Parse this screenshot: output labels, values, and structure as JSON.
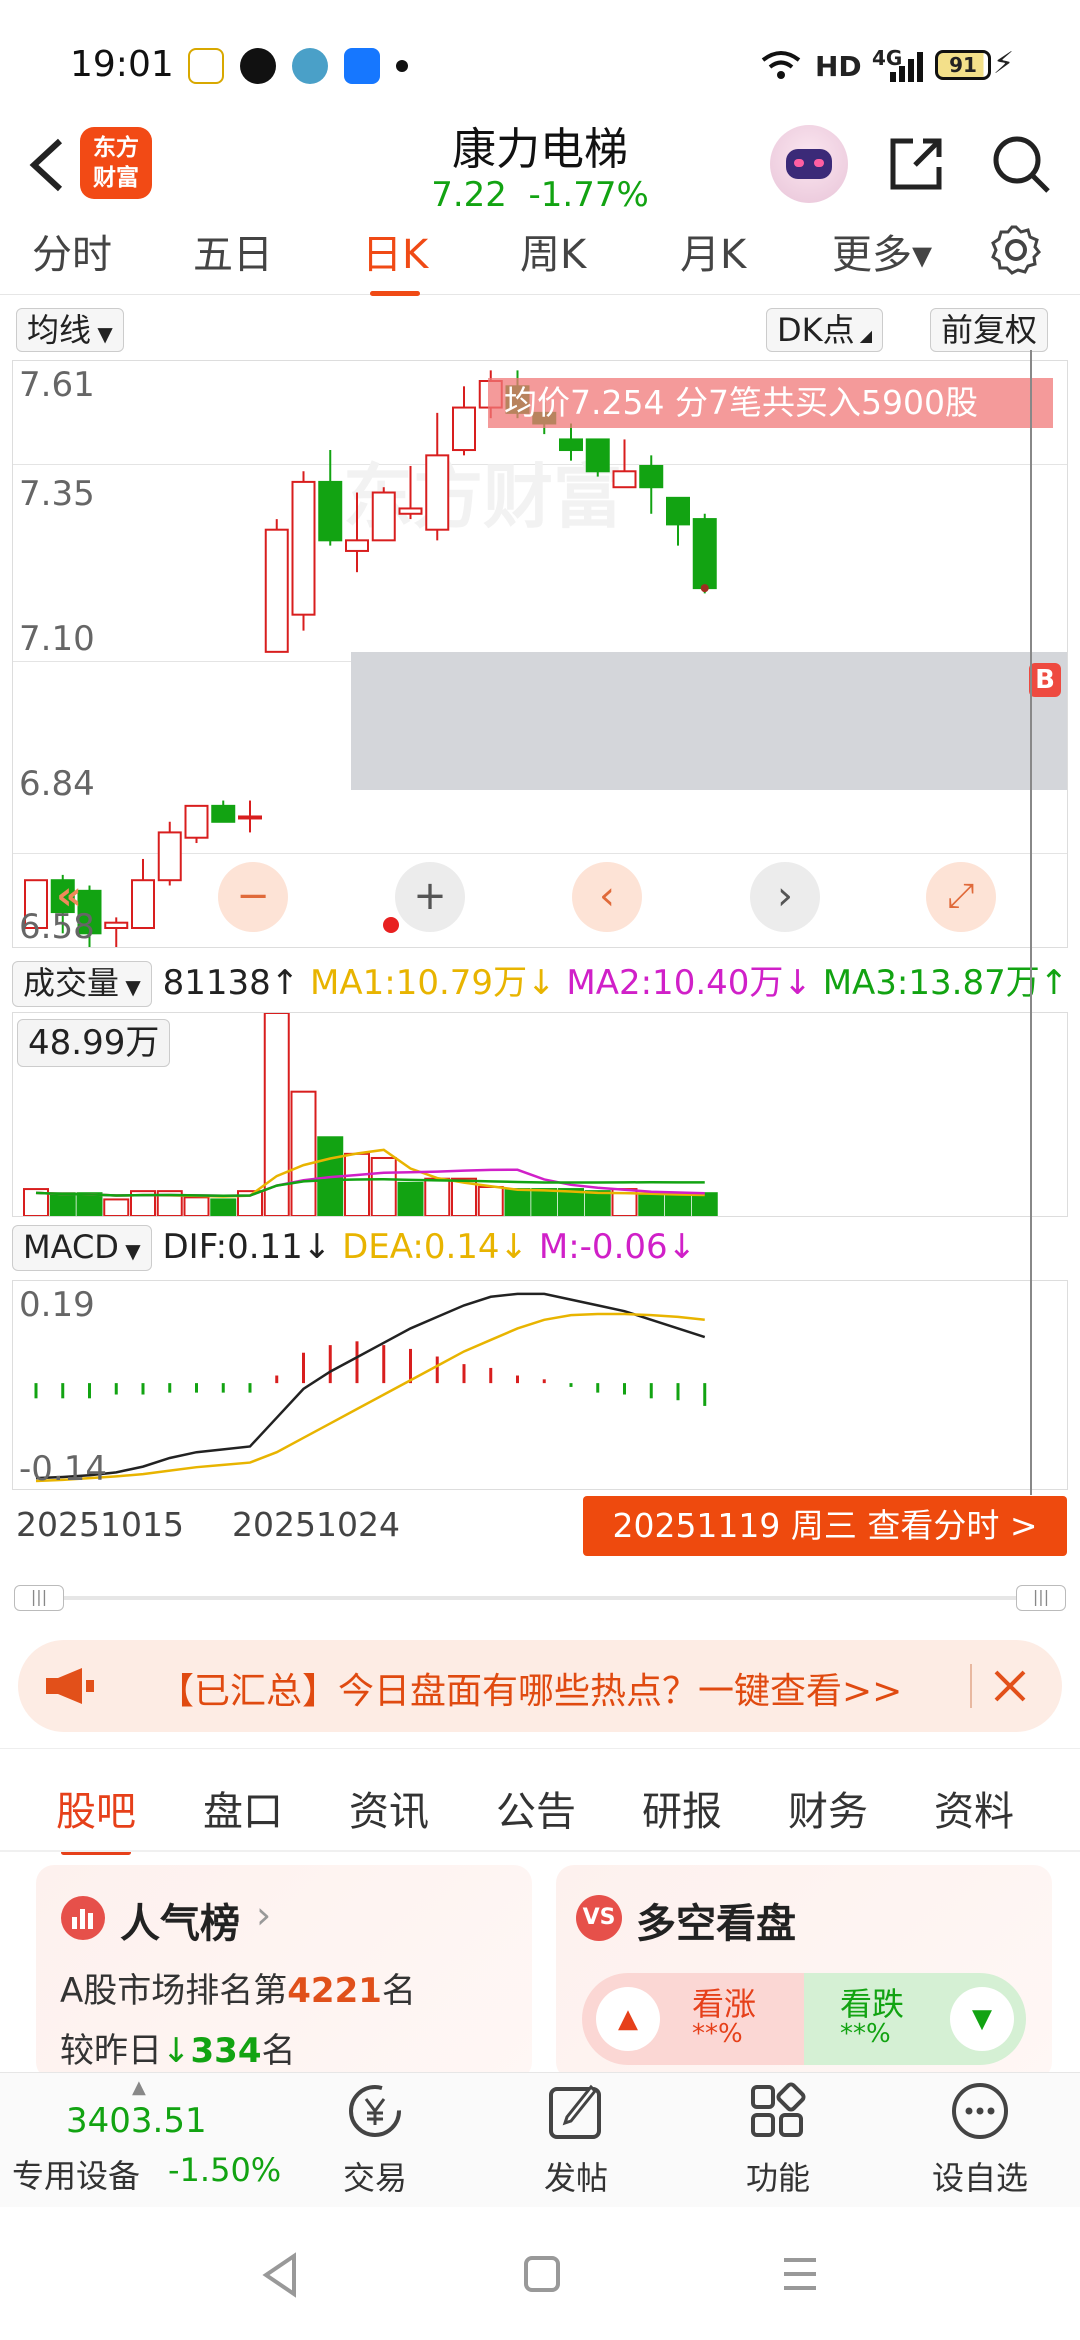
{
  "status_bar": {
    "time": "19:01",
    "net_label": "HD",
    "cell_label": "4G",
    "battery": "91"
  },
  "header": {
    "logo_text": "东方\n财富",
    "title": "康力电梯",
    "price": "7.22",
    "change": "-1.77%"
  },
  "period_tabs": [
    "分时",
    "五日",
    "日K",
    "周K",
    "月K",
    "更多▾"
  ],
  "active_period": "日K",
  "chart_controls": {
    "ma_label": "均线",
    "dk_label": "DK点",
    "adjust_label": "前复权",
    "buy_marker": "B",
    "watermark": "东方财富"
  },
  "trade_tip": "均价7.254 分7笔共买入5900股",
  "colors": {
    "up": "#d81e1e",
    "down": "#12a312",
    "ma1": "#e8b400",
    "ma2": "#d020c8",
    "ma3": "#12a312",
    "accent": "#ee4a0e"
  },
  "chart_data": [
    {
      "type": "candlestick",
      "ylabels": [
        "7.61",
        "7.35",
        "7.10",
        "6.84",
        "6.58"
      ],
      "ylim": [
        6.58,
        7.61
      ],
      "highlight_band": [
        6.84,
        7.1
      ],
      "candles": [
        {
          "o": 6.58,
          "c": 6.67,
          "h": 6.67,
          "l": 6.58
        },
        {
          "o": 6.67,
          "c": 6.61,
          "h": 6.68,
          "l": 6.57
        },
        {
          "o": 6.65,
          "c": 6.57,
          "h": 6.66,
          "l": 6.53
        },
        {
          "o": 6.58,
          "c": 6.59,
          "h": 6.6,
          "l": 6.54
        },
        {
          "o": 6.58,
          "c": 6.67,
          "h": 6.71,
          "l": 6.58
        },
        {
          "o": 6.67,
          "c": 6.76,
          "h": 6.78,
          "l": 6.66
        },
        {
          "o": 6.75,
          "c": 6.81,
          "h": 6.81,
          "l": 6.74
        },
        {
          "o": 6.81,
          "c": 6.78,
          "h": 6.82,
          "l": 6.78
        },
        {
          "o": 6.79,
          "c": 6.79,
          "h": 6.82,
          "l": 6.76
        },
        {
          "o": 7.1,
          "c": 7.33,
          "h": 7.35,
          "l": 7.1
        },
        {
          "o": 7.17,
          "c": 7.42,
          "h": 7.44,
          "l": 7.14
        },
        {
          "o": 7.42,
          "c": 7.31,
          "h": 7.48,
          "l": 7.3
        },
        {
          "o": 7.29,
          "c": 7.31,
          "h": 7.4,
          "l": 7.25
        },
        {
          "o": 7.31,
          "c": 7.4,
          "h": 7.41,
          "l": 7.31
        },
        {
          "o": 7.36,
          "c": 7.37,
          "h": 7.45,
          "l": 7.35
        },
        {
          "o": 7.33,
          "c": 7.47,
          "h": 7.55,
          "l": 7.31
        },
        {
          "o": 7.48,
          "c": 7.56,
          "h": 7.6,
          "l": 7.47
        },
        {
          "o": 7.56,
          "c": 7.61,
          "h": 7.63,
          "l": 7.54
        },
        {
          "o": 7.6,
          "c": 7.55,
          "h": 7.63,
          "l": 7.54
        },
        {
          "o": 7.55,
          "c": 7.53,
          "h": 7.57,
          "l": 7.51
        },
        {
          "o": 7.5,
          "c": 7.48,
          "h": 7.53,
          "l": 7.46
        },
        {
          "o": 7.5,
          "c": 7.44,
          "h": 7.5,
          "l": 7.43
        },
        {
          "o": 7.41,
          "c": 7.44,
          "h": 7.5,
          "l": 7.41
        },
        {
          "o": 7.45,
          "c": 7.41,
          "h": 7.47,
          "l": 7.36
        },
        {
          "o": 7.39,
          "c": 7.34,
          "h": 7.39,
          "l": 7.3
        },
        {
          "o": 7.35,
          "c": 7.22,
          "h": 7.36,
          "l": 7.21
        }
      ]
    },
    {
      "type": "bar",
      "title": "成交量",
      "legend": {
        "vol": "81138↑",
        "ma1": "MA1:10.79万↓",
        "ma2": "MA2:10.40万↓",
        "ma3": "MA3:13.87万↑"
      },
      "max_label": "48.99万",
      "ylim": [
        0,
        48.99
      ],
      "values": [
        6.5,
        5.5,
        5.5,
        4,
        6,
        6,
        4.5,
        4,
        6,
        48.99,
        30,
        19,
        15,
        14,
        8,
        9,
        9,
        7,
        6.5,
        6.5,
        6.5,
        6,
        6.5,
        5,
        5,
        5.5
      ],
      "dirs": [
        "u",
        "d",
        "d",
        "u",
        "u",
        "u",
        "u",
        "d",
        "u",
        "u",
        "u",
        "d",
        "u",
        "u",
        "d",
        "u",
        "u",
        "u",
        "d",
        "d",
        "d",
        "d",
        "u",
        "d",
        "d",
        "d"
      ]
    },
    {
      "type": "bar",
      "title": "MACD",
      "legend": {
        "dif": "DIF:0.11↓",
        "dea": "DEA:0.14↓",
        "m": "M:-0.06↓"
      },
      "ylabels": [
        "0.19",
        "-0.14"
      ],
      "ylim": [
        -0.14,
        0.19
      ],
      "hist": [
        -0.04,
        -0.04,
        -0.04,
        -0.03,
        -0.03,
        -0.025,
        -0.025,
        -0.025,
        -0.025,
        0.02,
        0.08,
        0.1,
        0.11,
        0.1,
        0.09,
        0.07,
        0.05,
        0.04,
        0.02,
        0.01,
        -0.01,
        -0.025,
        -0.03,
        -0.04,
        -0.045,
        -0.06
      ],
      "dif": [
        -0.135,
        -0.133,
        -0.13,
        -0.125,
        -0.115,
        -0.1,
        -0.09,
        -0.085,
        -0.08,
        -0.03,
        0.02,
        0.05,
        0.075,
        0.1,
        0.125,
        0.145,
        0.165,
        0.18,
        0.185,
        0.185,
        0.175,
        0.165,
        0.155,
        0.14,
        0.125,
        0.11
      ],
      "dea": [
        -0.14,
        -0.138,
        -0.135,
        -0.132,
        -0.128,
        -0.122,
        -0.116,
        -0.112,
        -0.108,
        -0.09,
        -0.065,
        -0.04,
        -0.015,
        0.01,
        0.035,
        0.06,
        0.085,
        0.105,
        0.125,
        0.14,
        0.148,
        0.15,
        0.15,
        0.148,
        0.145,
        0.14
      ]
    }
  ],
  "dates": {
    "d1": "20251015",
    "d2": "20251024",
    "selected": "20251119 周三 查看分时 >"
  },
  "banner": {
    "text": "【已汇总】今日盘面有哪些热点？一键查看>>"
  },
  "info_tabs": [
    "股吧",
    "盘口",
    "资讯",
    "公告",
    "研报",
    "财务",
    "资料"
  ],
  "active_info_tab": "股吧",
  "popularity": {
    "title": "人气榜",
    "chevron": "›",
    "rank_prefix": "A股市场排名第",
    "rank": "4221",
    "rank_suffix": "名",
    "change_prefix": "较昨日",
    "change_value": "334",
    "change_suffix": "名"
  },
  "sentiment": {
    "badge": "VS",
    "title": "多空看盘",
    "bull_label": "看涨",
    "bull_pct": "**%",
    "bear_label": "看跌",
    "bear_pct": "**%"
  },
  "bottom_bar": {
    "index_value": "3403.51",
    "index_name": "专用设备",
    "index_change": "-1.50%",
    "items": [
      "交易",
      "发帖",
      "功能",
      "设自选"
    ]
  }
}
